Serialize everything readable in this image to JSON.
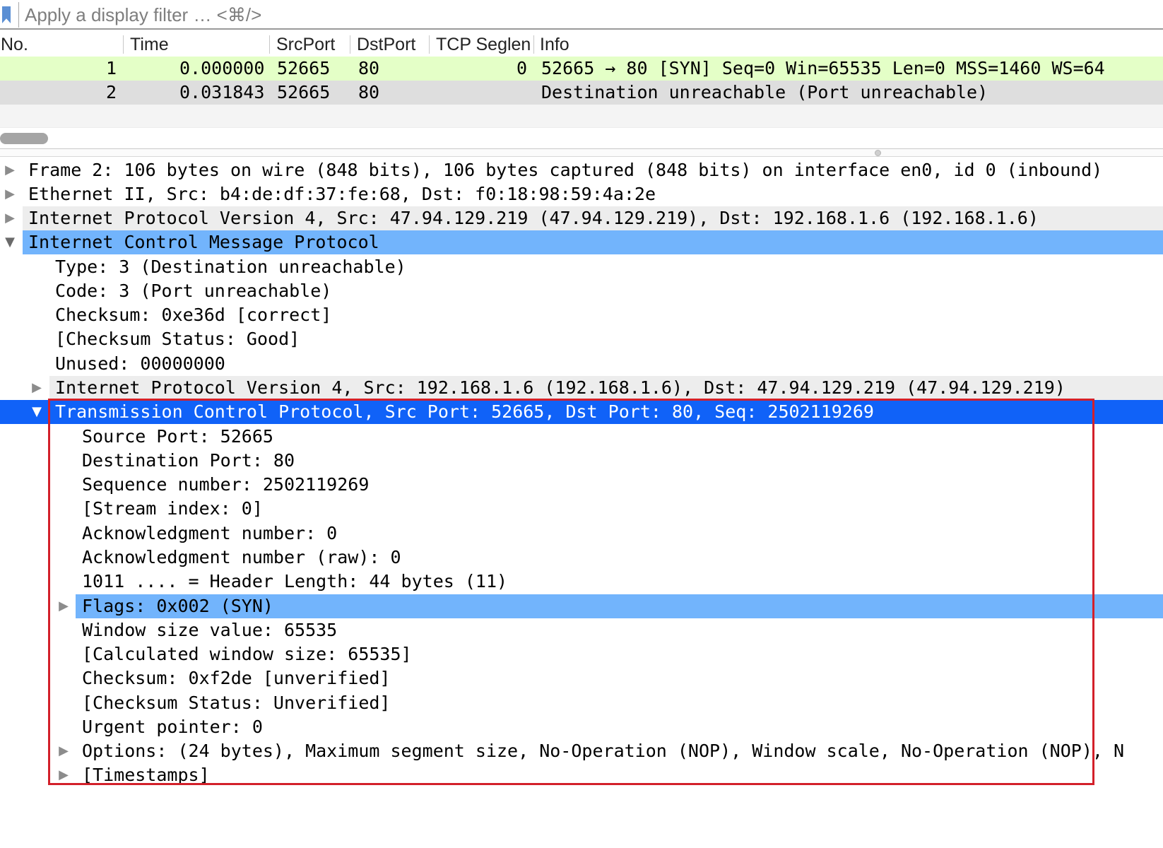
{
  "filter": {
    "placeholder": "Apply a display filter … <⌘/>"
  },
  "packet_list": {
    "columns": [
      "No.",
      "Time",
      "SrcPort",
      "DstPort",
      "TCP Seglen",
      "Info"
    ],
    "rows": [
      {
        "no": "1",
        "time": "0.000000",
        "srcport": "52665",
        "dstport": "80",
        "seglen": "0",
        "info": "52665 → 80 [SYN] Seq=0 Win=65535 Len=0 MSS=1460 WS=64",
        "color": "#e4ffc7"
      },
      {
        "no": "2",
        "time": "0.031843",
        "srcport": "52665",
        "dstport": "80",
        "seglen": "",
        "info": "Destination unreachable (Port unreachable)",
        "color": "#dedede"
      }
    ]
  },
  "details": {
    "frame": "Frame 2: 106 bytes on wire (848 bits), 106 bytes captured (848 bits) on interface en0, id 0 (inbound)",
    "ethernet": "Ethernet II, Src: b4:de:df:37:fe:68, Dst: f0:18:98:59:4a:2e",
    "ipv4": "Internet Protocol Version 4, Src: 47.94.129.219 (47.94.129.219), Dst: 192.168.1.6 (192.168.1.6)",
    "icmp": {
      "title": "Internet Control Message Protocol",
      "fields": [
        "Type: 3 (Destination unreachable)",
        "Code: 3 (Port unreachable)",
        "Checksum: 0xe36d [correct]",
        "[Checksum Status: Good]",
        "Unused: 00000000"
      ],
      "inner_ipv4": "Internet Protocol Version 4, Src: 192.168.1.6 (192.168.1.6), Dst: 47.94.129.219 (47.94.129.219)",
      "tcp": {
        "title": "Transmission Control Protocol, Src Port: 52665, Dst Port: 80, Seq: 2502119269",
        "fields": [
          "Source Port: 52665",
          "Destination Port: 80",
          "Sequence number: 2502119269",
          "[Stream index: 0]",
          "Acknowledgment number: 0",
          "Acknowledgment number (raw): 0",
          "1011 .... = Header Length: 44 bytes (11)"
        ],
        "flags": "Flags: 0x002 (SYN)",
        "fields2": [
          "Window size value: 65535",
          "[Calculated window size: 65535]",
          "Checksum: 0xf2de [unverified]",
          "[Checksum Status: Unverified]",
          "Urgent pointer: 0"
        ],
        "options": "Options: (24 bytes), Maximum segment size, No-Operation (NOP), Window scale, No-Operation (NOP), N",
        "timestamps": "[Timestamps]"
      }
    }
  },
  "colors": {
    "selected_light": "#72b4fc",
    "selected_dark": "#1062f8",
    "annotation": "#d3202a",
    "syn_row": "#e4ffc7"
  }
}
